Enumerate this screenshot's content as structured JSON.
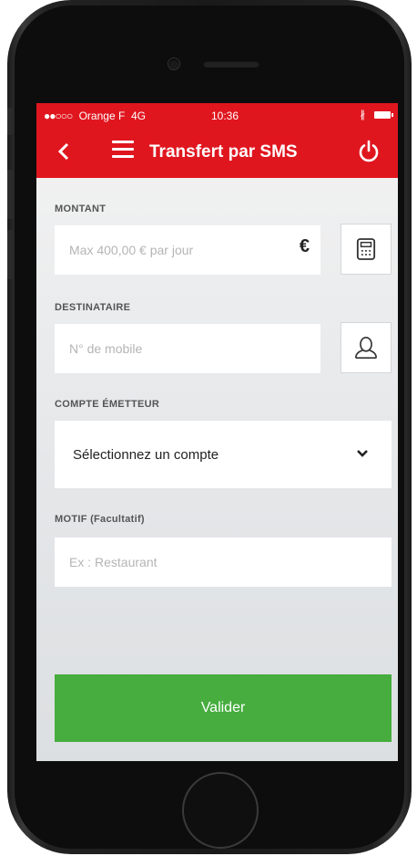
{
  "status_bar": {
    "signal_dots": "●●○○○",
    "carrier": "Orange F",
    "network": "4G",
    "time": "10:36",
    "bluetooth": "∦"
  },
  "app_bar": {
    "title": "Transfert par SMS",
    "back_icon": "chevron-left-icon",
    "menu_icon": "hamburger-menu-icon",
    "logout_icon": "power-icon"
  },
  "form": {
    "amount": {
      "label": "MONTANT",
      "placeholder": "Max 400,00 € par jour",
      "currency_symbol": "€",
      "action_icon": "calculator-icon"
    },
    "recipient": {
      "label": "DESTINATAIRE",
      "placeholder": "N° de mobile",
      "action_icon": "contact-person-icon"
    },
    "account": {
      "label": "COMPTE ÉMETTEUR",
      "selected": "Sélectionnez un compte"
    },
    "reason": {
      "label": "MOTIF (Facultatif)",
      "placeholder": "Ex : Restaurant"
    },
    "submit_label": "Valider"
  },
  "colors": {
    "brand_red": "#e0161f",
    "submit_green": "#46ad3e"
  }
}
